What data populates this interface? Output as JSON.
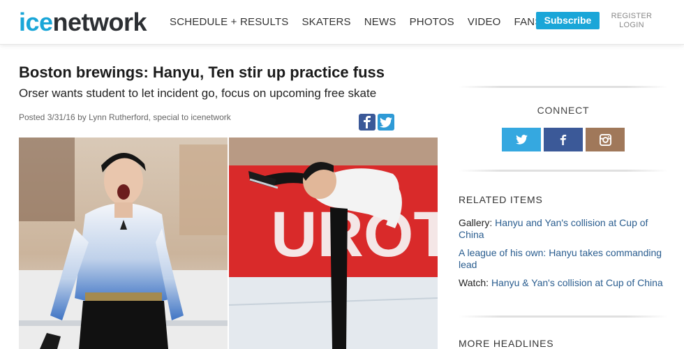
{
  "header": {
    "logo_ice": "ice",
    "logo_network": "network",
    "nav": [
      "SCHEDULE + RESULTS",
      "SKATERS",
      "NEWS",
      "PHOTOS",
      "VIDEO",
      "FANS"
    ],
    "subscribe": "Subscribe",
    "register": "REGISTER",
    "login": "LOGIN"
  },
  "article": {
    "headline": "Boston brewings: Hanyu, Ten stir up practice fuss",
    "subhead": "Orser wants student to let incident go, focus on upcoming free skate",
    "byline": "Posted 3/31/16 by Lynn Rutherford, special to icenetwork"
  },
  "sidebar": {
    "connect": "CONNECT",
    "related_title": "RELATED ITEMS",
    "related": [
      {
        "prefix": "Gallery: ",
        "link": "Hanyu and Yan's collision at Cup of China"
      },
      {
        "prefix": "",
        "link": "A league of his own: Hanyu takes commanding lead"
      },
      {
        "prefix": "Watch: ",
        "link": "Hanyu & Yan's collision at Cup of China"
      }
    ],
    "more_title": "MORE HEADLINES"
  },
  "colors": {
    "brand_blue": "#1aa6d8",
    "facebook": "#3b5998",
    "twitter": "#35a8e0",
    "instagram": "#a0785a",
    "link": "#2a5d8f"
  },
  "icons": {
    "share": [
      "facebook-icon",
      "twitter-icon"
    ],
    "social": [
      "twitter-icon",
      "facebook-icon",
      "instagram-icon"
    ]
  }
}
